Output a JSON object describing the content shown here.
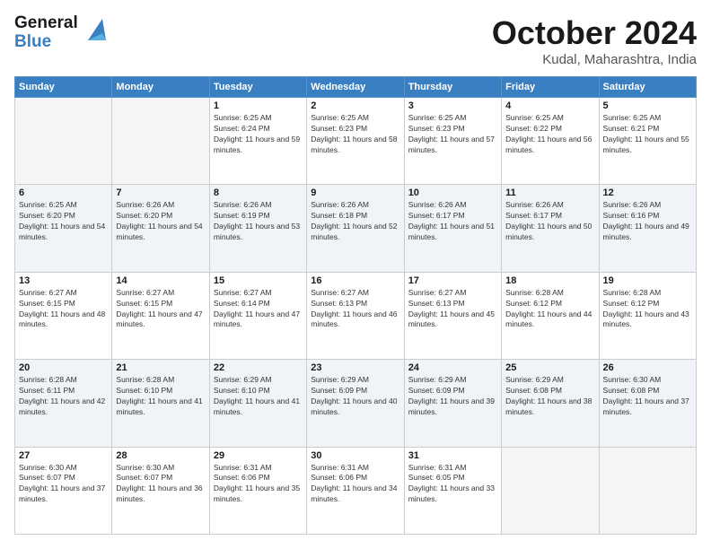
{
  "logo": {
    "general": "General",
    "blue": "Blue"
  },
  "title": "October 2024",
  "location": "Kudal, Maharashtra, India",
  "days_of_week": [
    "Sunday",
    "Monday",
    "Tuesday",
    "Wednesday",
    "Thursday",
    "Friday",
    "Saturday"
  ],
  "weeks": [
    [
      {
        "day": "",
        "empty": true
      },
      {
        "day": "",
        "empty": true
      },
      {
        "day": "1",
        "sunrise": "6:25 AM",
        "sunset": "6:24 PM",
        "daylight": "11 hours and 59 minutes."
      },
      {
        "day": "2",
        "sunrise": "6:25 AM",
        "sunset": "6:23 PM",
        "daylight": "11 hours and 58 minutes."
      },
      {
        "day": "3",
        "sunrise": "6:25 AM",
        "sunset": "6:23 PM",
        "daylight": "11 hours and 57 minutes."
      },
      {
        "day": "4",
        "sunrise": "6:25 AM",
        "sunset": "6:22 PM",
        "daylight": "11 hours and 56 minutes."
      },
      {
        "day": "5",
        "sunrise": "6:25 AM",
        "sunset": "6:21 PM",
        "daylight": "11 hours and 55 minutes."
      }
    ],
    [
      {
        "day": "6",
        "sunrise": "6:25 AM",
        "sunset": "6:20 PM",
        "daylight": "11 hours and 54 minutes."
      },
      {
        "day": "7",
        "sunrise": "6:26 AM",
        "sunset": "6:20 PM",
        "daylight": "11 hours and 54 minutes."
      },
      {
        "day": "8",
        "sunrise": "6:26 AM",
        "sunset": "6:19 PM",
        "daylight": "11 hours and 53 minutes."
      },
      {
        "day": "9",
        "sunrise": "6:26 AM",
        "sunset": "6:18 PM",
        "daylight": "11 hours and 52 minutes."
      },
      {
        "day": "10",
        "sunrise": "6:26 AM",
        "sunset": "6:17 PM",
        "daylight": "11 hours and 51 minutes."
      },
      {
        "day": "11",
        "sunrise": "6:26 AM",
        "sunset": "6:17 PM",
        "daylight": "11 hours and 50 minutes."
      },
      {
        "day": "12",
        "sunrise": "6:26 AM",
        "sunset": "6:16 PM",
        "daylight": "11 hours and 49 minutes."
      }
    ],
    [
      {
        "day": "13",
        "sunrise": "6:27 AM",
        "sunset": "6:15 PM",
        "daylight": "11 hours and 48 minutes."
      },
      {
        "day": "14",
        "sunrise": "6:27 AM",
        "sunset": "6:15 PM",
        "daylight": "11 hours and 47 minutes."
      },
      {
        "day": "15",
        "sunrise": "6:27 AM",
        "sunset": "6:14 PM",
        "daylight": "11 hours and 47 minutes."
      },
      {
        "day": "16",
        "sunrise": "6:27 AM",
        "sunset": "6:13 PM",
        "daylight": "11 hours and 46 minutes."
      },
      {
        "day": "17",
        "sunrise": "6:27 AM",
        "sunset": "6:13 PM",
        "daylight": "11 hours and 45 minutes."
      },
      {
        "day": "18",
        "sunrise": "6:28 AM",
        "sunset": "6:12 PM",
        "daylight": "11 hours and 44 minutes."
      },
      {
        "day": "19",
        "sunrise": "6:28 AM",
        "sunset": "6:12 PM",
        "daylight": "11 hours and 43 minutes."
      }
    ],
    [
      {
        "day": "20",
        "sunrise": "6:28 AM",
        "sunset": "6:11 PM",
        "daylight": "11 hours and 42 minutes."
      },
      {
        "day": "21",
        "sunrise": "6:28 AM",
        "sunset": "6:10 PM",
        "daylight": "11 hours and 41 minutes."
      },
      {
        "day": "22",
        "sunrise": "6:29 AM",
        "sunset": "6:10 PM",
        "daylight": "11 hours and 41 minutes."
      },
      {
        "day": "23",
        "sunrise": "6:29 AM",
        "sunset": "6:09 PM",
        "daylight": "11 hours and 40 minutes."
      },
      {
        "day": "24",
        "sunrise": "6:29 AM",
        "sunset": "6:09 PM",
        "daylight": "11 hours and 39 minutes."
      },
      {
        "day": "25",
        "sunrise": "6:29 AM",
        "sunset": "6:08 PM",
        "daylight": "11 hours and 38 minutes."
      },
      {
        "day": "26",
        "sunrise": "6:30 AM",
        "sunset": "6:08 PM",
        "daylight": "11 hours and 37 minutes."
      }
    ],
    [
      {
        "day": "27",
        "sunrise": "6:30 AM",
        "sunset": "6:07 PM",
        "daylight": "11 hours and 37 minutes."
      },
      {
        "day": "28",
        "sunrise": "6:30 AM",
        "sunset": "6:07 PM",
        "daylight": "11 hours and 36 minutes."
      },
      {
        "day": "29",
        "sunrise": "6:31 AM",
        "sunset": "6:06 PM",
        "daylight": "11 hours and 35 minutes."
      },
      {
        "day": "30",
        "sunrise": "6:31 AM",
        "sunset": "6:06 PM",
        "daylight": "11 hours and 34 minutes."
      },
      {
        "day": "31",
        "sunrise": "6:31 AM",
        "sunset": "6:05 PM",
        "daylight": "11 hours and 33 minutes."
      },
      {
        "day": "",
        "empty": true
      },
      {
        "day": "",
        "empty": true
      }
    ]
  ]
}
